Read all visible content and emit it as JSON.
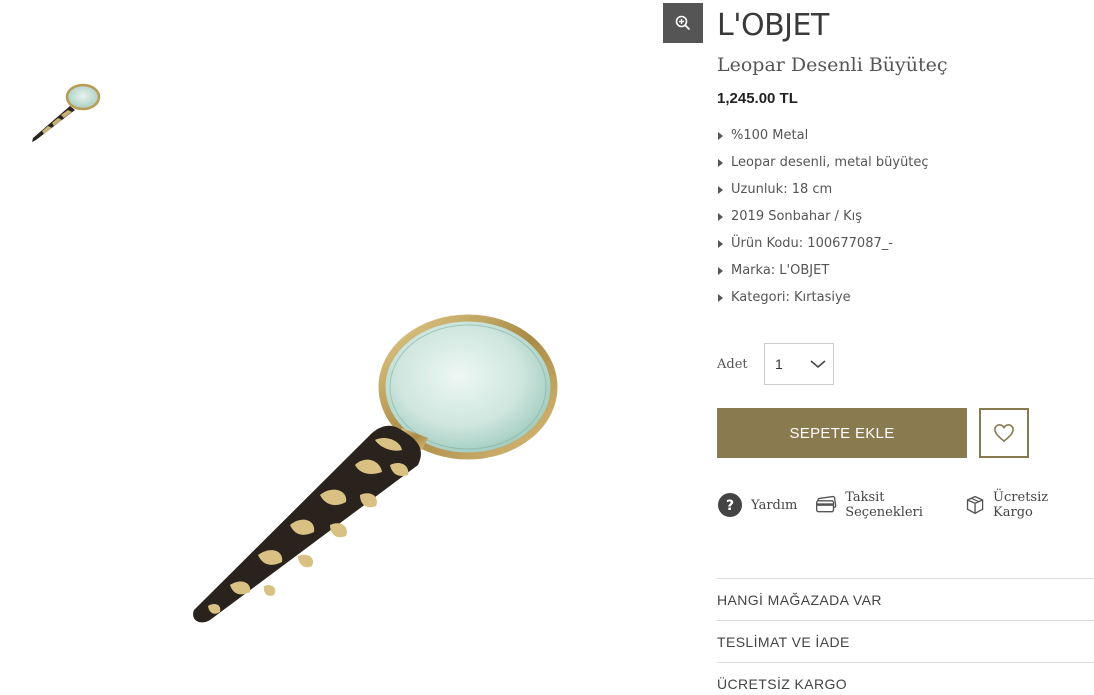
{
  "product": {
    "brand": "L'OBJET",
    "name": "Leopar Desenli Büyüteç",
    "price": "1,245.00 TL",
    "features": [
      "%100 Metal",
      "Leopar desenli, metal büyüteç",
      "Uzunluk: 18 cm",
      "2019 Sonbahar / Kış",
      "Ürün Kodu: 100677087_-",
      "Marka: L'OBJET",
      "Kategori: Kırtasiye"
    ]
  },
  "quantity": {
    "label": "Adet",
    "value": "1"
  },
  "actions": {
    "add_to_cart": "SEPETE EKLE"
  },
  "info_links": [
    "Yardım",
    "Taksit Seçenekleri",
    "Ücretsiz Kargo"
  ],
  "accordion": [
    "HANGİ MAĞAZADA VAR",
    "TESLİMAT VE İADE",
    "ÜCRETSİZ KARGO"
  ],
  "colors": {
    "accent": "#8a7a50",
    "zoom_bg": "#555555"
  },
  "icons": [
    "zoom-in-icon",
    "chevron-down-icon",
    "heart-icon",
    "help-icon",
    "credit-card-icon",
    "box-icon"
  ]
}
